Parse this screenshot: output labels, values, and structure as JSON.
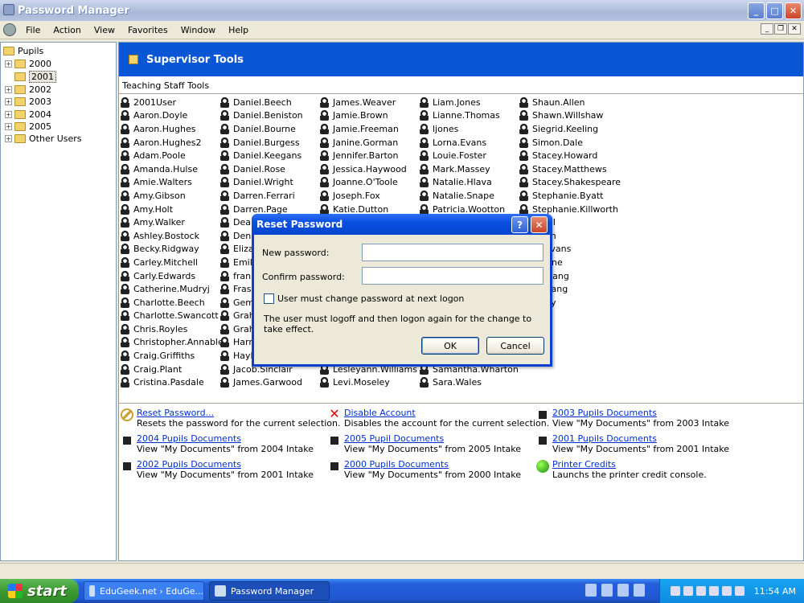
{
  "window": {
    "title": "Password Manager",
    "min": "_",
    "max": "□",
    "close": "✕"
  },
  "menu": [
    "File",
    "Action",
    "View",
    "Favorites",
    "Window",
    "Help"
  ],
  "mdi": {
    "min": "_",
    "restore": "❐",
    "close": "✕"
  },
  "tree": {
    "root": "Pupils",
    "items": [
      "2000",
      "2001",
      "2002",
      "2003",
      "2004",
      "2005",
      "Other Users"
    ],
    "selected": "2001"
  },
  "banner": {
    "title": "Supervisor Tools"
  },
  "section": "Teaching Staff Tools",
  "users": {
    "col1": [
      "2001User",
      "Aaron.Doyle",
      "Aaron.Hughes",
      "Aaron.Hughes2",
      "Adam.Poole",
      "Amanda.Hulse",
      "Amie.Walters",
      "Amy.Gibson",
      "Amy.Holt",
      "Amy.Walker",
      "Ashley.Bostock",
      "Becky.Ridgway",
      "Carley.Mitchell",
      "Carly.Edwards",
      "Catherine.Mudryj",
      "Charlotte.Beech",
      "Charlotte.Swancott",
      "Chris.Royles",
      "Christopher.Annable",
      "Craig.Griffiths",
      "Craig.Plant",
      "Cristina.Pasdale"
    ],
    "col2": [
      "Daniel.Beech",
      "Daniel.Beniston",
      "Daniel.Bourne",
      "Daniel.Burgess",
      "Daniel.Keegans",
      "Daniel.Rose",
      "Daniel.Wright",
      "Darren.Ferrari",
      "Darren.Page",
      "Dean",
      "Denn",
      "Eliza",
      "Emily",
      "frank",
      "Frase",
      "Gemm",
      "Graha",
      "Graha",
      "Harri",
      "Hayle",
      "Jacob.Sinclair",
      "James.Garwood"
    ],
    "col3": [
      "James.Weaver",
      "Jamie.Brown",
      "Jamie.Freeman",
      "Janine.Gorman",
      "Jennifer.Barton",
      "Jessica.Haywood",
      "Joanne.O'Toole",
      "Joseph.Fox",
      "Katie.Dutton",
      "",
      "",
      "",
      "",
      "",
      "",
      "",
      "",
      "",
      "",
      "",
      "Lesleyann.Williams",
      "Levi.Moseley"
    ],
    "col4": [
      "Liam.Jones",
      "Lianne.Thomas",
      "ljones",
      "Lorna.Evans",
      "Louie.Foster",
      "Mark.Massey",
      "Natalie.Hlava",
      "Natalie.Snape",
      "Patricia.Wootton",
      "",
      "",
      "",
      "",
      "",
      "",
      "",
      "",
      "",
      "",
      "",
      "Samantha.Wharton",
      "Sara.Wales"
    ],
    "col5": [
      "Shaun.Allen",
      "Shawn.Willshaw",
      "Siegrid.Keeling",
      "Simon.Dale",
      "Stacey.Howard",
      "Stacey.Matthews",
      "Stacey.Shakespeare",
      "Stephanie.Byatt",
      "Stephanie.Killworth",
      "e.Fell",
      "Leigh",
      "ny.Evans",
      "y.Milne",
      "n.Chang",
      "n.chang",
      "ayley"
    ]
  },
  "tasks": [
    {
      "label": "Reset Password...",
      "desc": "Resets the password for the current selection.",
      "icon": "key-icon"
    },
    {
      "label": "Disable Account",
      "desc": "Disables the account for the current selection.",
      "icon": "red-x-icon"
    },
    {
      "label": "2003 Pupils Documents",
      "desc": "View \"My Documents\" from 2003 Intake",
      "icon": "user-doc-icon"
    },
    {
      "label": "2004 Pupils Documents",
      "desc": "View \"My Documents\" from 2004 Intake",
      "icon": "user-doc-icon"
    },
    {
      "label": "2005 Pupil Documents",
      "desc": "View \"My Documents\" from 2005 Intake",
      "icon": "user-doc-icon"
    },
    {
      "label": "2001 Pupils Documents",
      "desc": "View \"My Documents\" from 2001 Intake",
      "icon": "user-doc-icon"
    },
    {
      "label": "2002 Pupils Documents",
      "desc": "View \"My Documents\" from 2001 Intake",
      "icon": "user-doc-icon"
    },
    {
      "label": "2000 Pupils Documents",
      "desc": "View \"My Documents\" from 2000 Intake",
      "icon": "user-doc-icon"
    },
    {
      "label": "Printer Credits",
      "desc": "Launchs the printer credit console.",
      "icon": "green-globe-icon"
    }
  ],
  "dialog": {
    "title": "Reset Password",
    "help": "?",
    "close": "✕",
    "new_label": "New password:",
    "confirm_label": "Confirm password:",
    "new_value": "",
    "confirm_value": "",
    "checkbox_label": "User must change password at next logon",
    "checkbox_checked": false,
    "note": "The user must logoff and then logon again for the change to take effect.",
    "ok": "OK",
    "cancel": "Cancel"
  },
  "taskbar": {
    "start": "start",
    "tasks": [
      {
        "label": "EduGeek.net › EduGe..."
      },
      {
        "label": "Password Manager"
      }
    ],
    "clock": "11:54 AM"
  }
}
